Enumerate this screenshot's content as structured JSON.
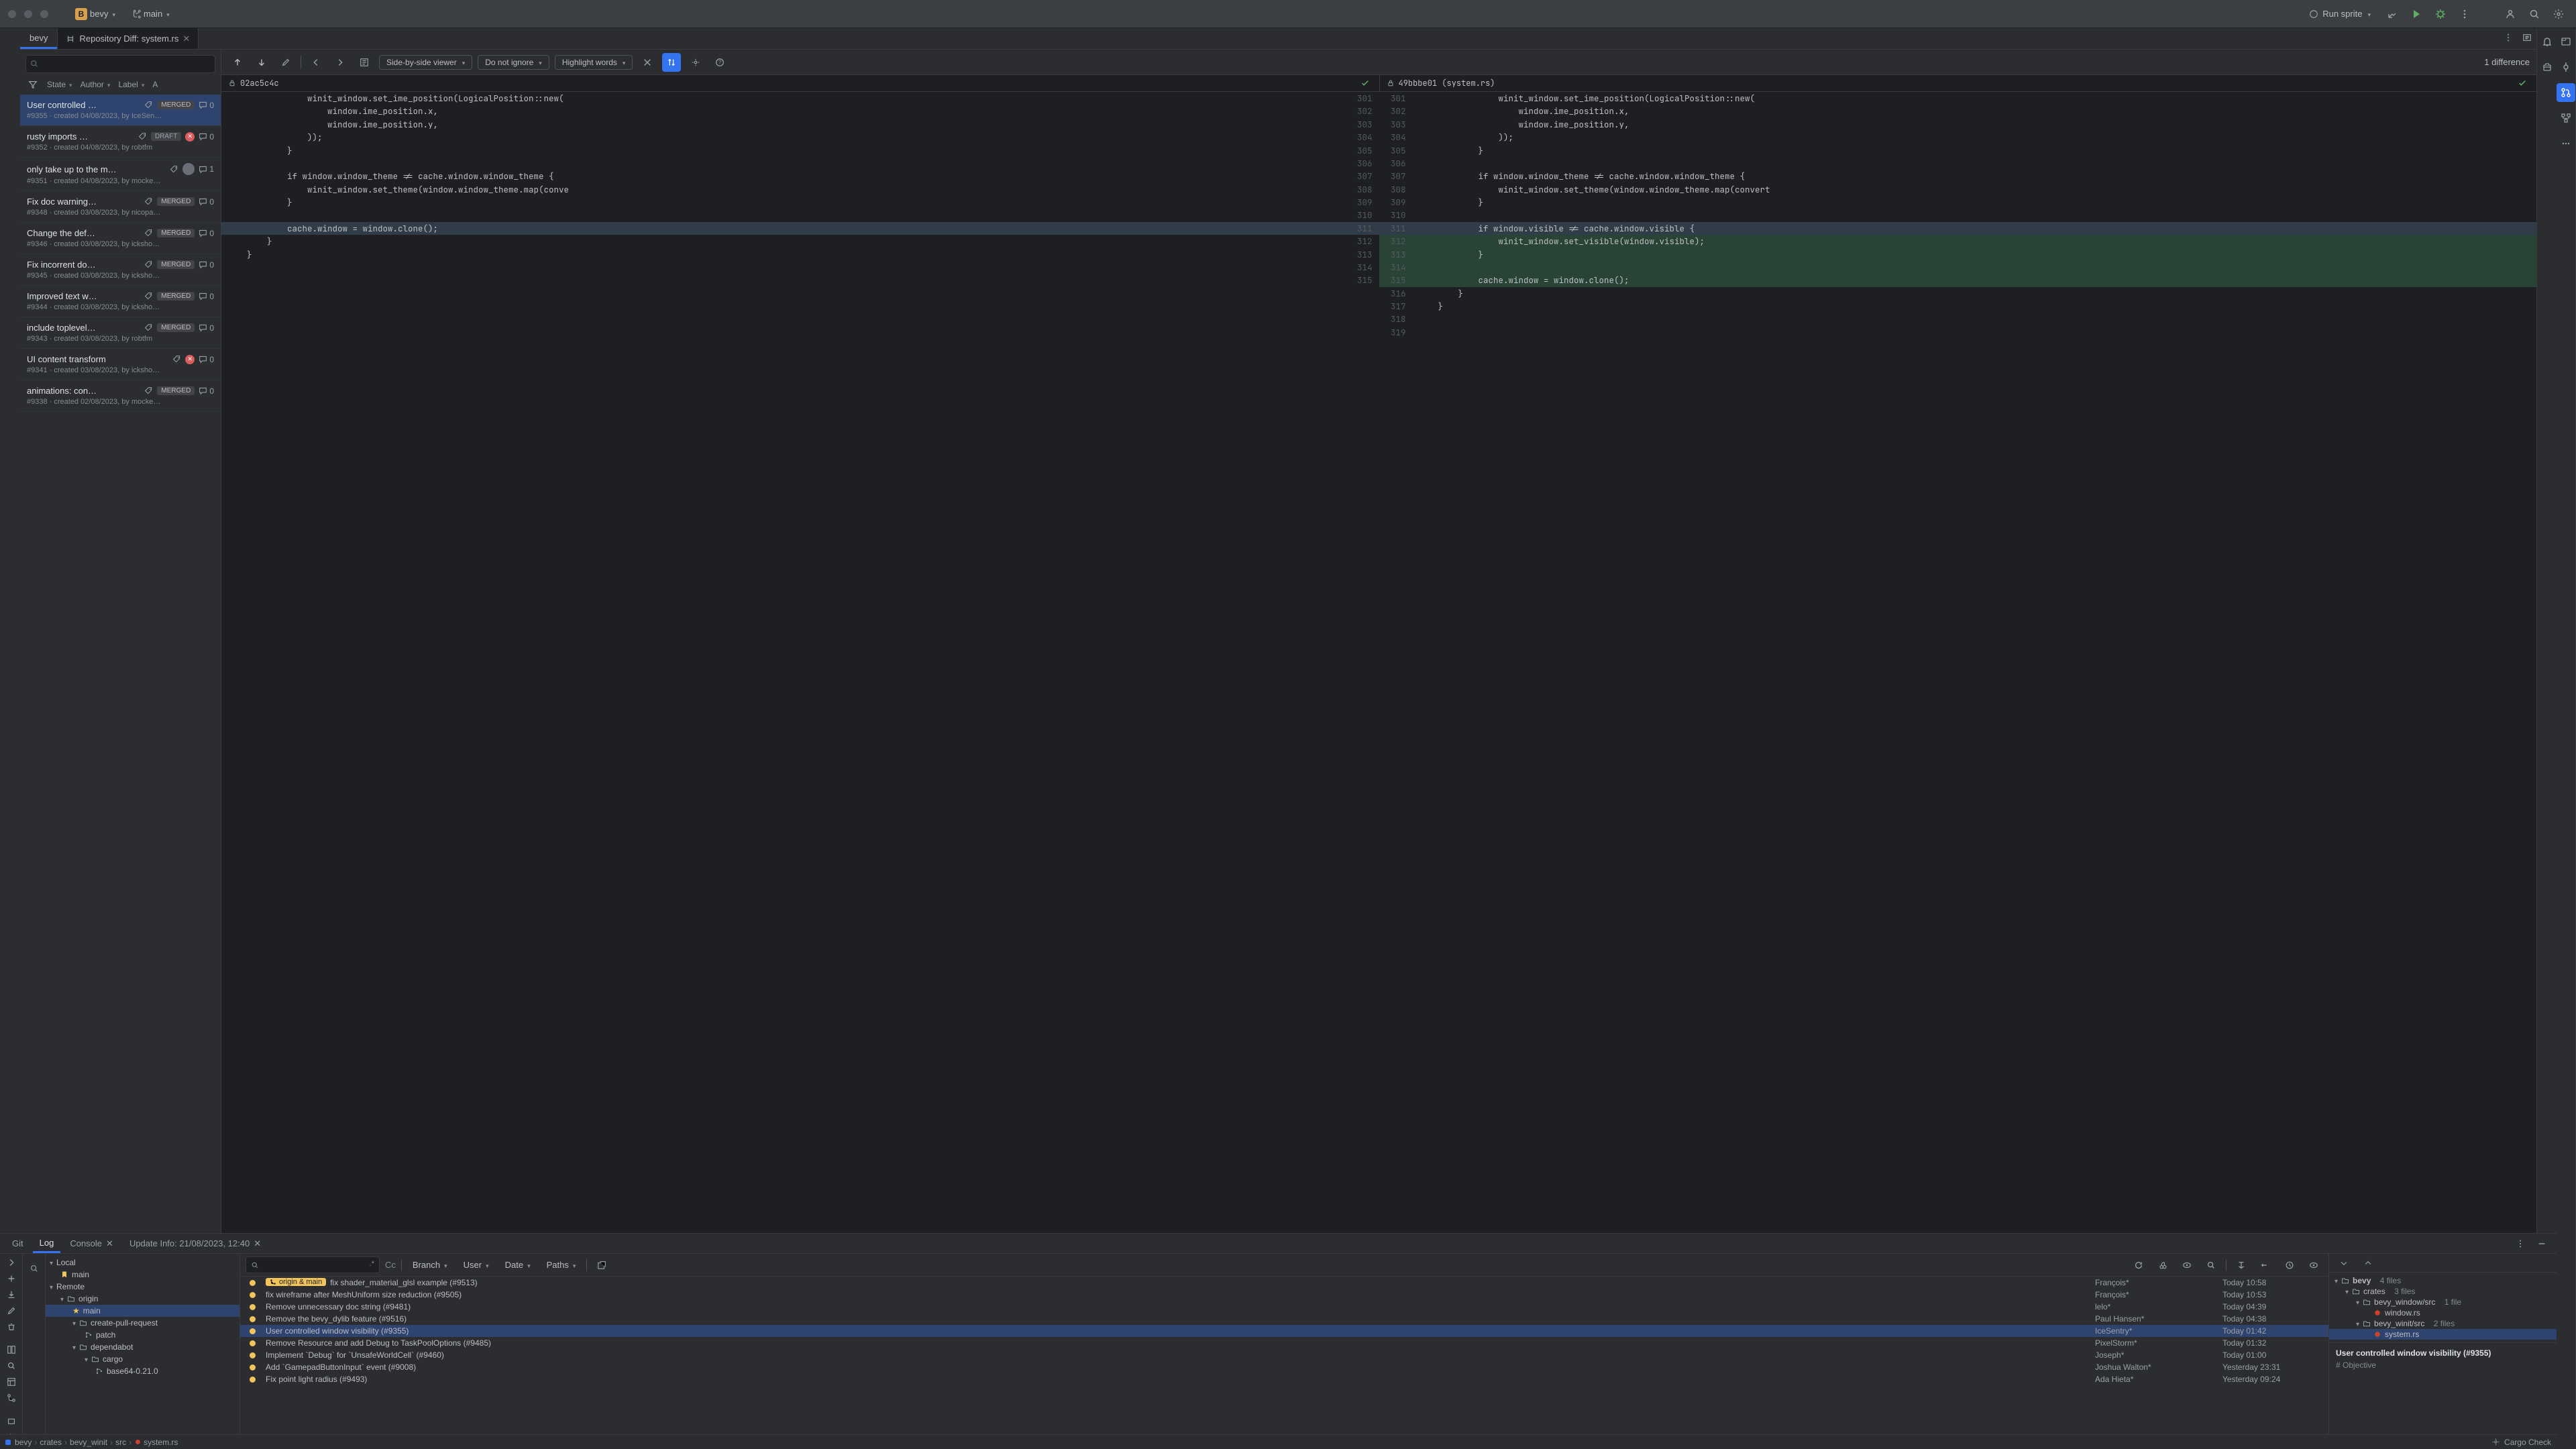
{
  "titlebar": {
    "project_initial": "B",
    "project_name": "bevy",
    "branch": "main",
    "run_config": "Run sprite"
  },
  "project_tab": "bevy",
  "editor_tab": "Repository Diff: system.rs",
  "filters": {
    "state": "State",
    "author": "Author",
    "label": "Label",
    "assignee": "A"
  },
  "pull_requests": [
    {
      "title": "User controlled …",
      "badge": "MERGED",
      "comments": "0",
      "meta": "#9355 · created 04/08/2023, by IceSen…",
      "sel": true
    },
    {
      "title": "rusty imports …",
      "badge": "DRAFT",
      "comments": "0",
      "meta": "#9352 · created 04/08/2023, by robtfm",
      "failed": true
    },
    {
      "title": "only take up to the m…",
      "badge": "",
      "comments": "1",
      "meta": "#9351 · created 04/08/2023, by mocke…",
      "avatar": true
    },
    {
      "title": "Fix doc warning…",
      "badge": "MERGED",
      "comments": "0",
      "meta": "#9348 · created 03/08/2023, by nicopa…"
    },
    {
      "title": "Change the def…",
      "badge": "MERGED",
      "comments": "0",
      "meta": "#9346 · created 03/08/2023, by icksho…"
    },
    {
      "title": "Fix incorrent do…",
      "badge": "MERGED",
      "comments": "0",
      "meta": "#9345 · created 03/08/2023, by icksho…"
    },
    {
      "title": "Improved text w…",
      "badge": "MERGED",
      "comments": "0",
      "meta": "#9344 · created 03/08/2023, by icksho…"
    },
    {
      "title": "include toplevel…",
      "badge": "MERGED",
      "comments": "0",
      "meta": "#9343 · created 03/08/2023, by robtfm"
    },
    {
      "title": "UI content transform",
      "badge": "",
      "comments": "0",
      "meta": "#9341 · created 03/08/2023, by icksho…",
      "failed": true
    },
    {
      "title": "animations: con…",
      "badge": "MERGED",
      "comments": "0",
      "meta": "#9338 · created 02/08/2023, by mocke…"
    }
  ],
  "diff_toolbar": {
    "viewer_mode": "Side-by-side viewer",
    "whitespace": "Do not ignore",
    "highlight": "Highlight words",
    "count": "1 difference"
  },
  "diff_header": {
    "left_rev": "02ac5c4c",
    "right_rev": "49bbbe01 (system.rs)"
  },
  "diff_lines": [
    {
      "l": "301",
      "r": "301",
      "lc": "                winit_window.set_ime_position(LogicalPosition::new(",
      "rc": "                winit_window.set_ime_position(LogicalPosition::new("
    },
    {
      "l": "302",
      "r": "302",
      "lc": "                    window.ime_position.x,",
      "rc": "                    window.ime_position.x,"
    },
    {
      "l": "303",
      "r": "303",
      "lc": "                    window.ime_position.y,",
      "rc": "                    window.ime_position.y,"
    },
    {
      "l": "304",
      "r": "304",
      "lc": "                ));",
      "rc": "                ));"
    },
    {
      "l": "305",
      "r": "305",
      "lc": "            }",
      "rc": "            }"
    },
    {
      "l": "306",
      "r": "306",
      "lc": "",
      "rc": ""
    },
    {
      "l": "307",
      "r": "307",
      "lc": "            if window.window_theme != cache.window.window_theme {",
      "rc": "            if window.window_theme != cache.window.window_theme {"
    },
    {
      "l": "308",
      "r": "308",
      "lc": "                winit_window.set_theme(window.window_theme.map(conve",
      "rc": "                winit_window.set_theme(window.window_theme.map(convert"
    },
    {
      "l": "309",
      "r": "309",
      "lc": "            }",
      "rc": "            }"
    },
    {
      "l": "310",
      "r": "310",
      "lc": "",
      "rc": ""
    },
    {
      "l": "311",
      "r": "311",
      "lc": "            cache.window = window.clone();",
      "rc": "            if window.visible != cache.window.visible {",
      "mod": true
    },
    {
      "l": "312",
      "r": "312",
      "lc": "        }",
      "rc": "                winit_window.set_visible(window.visible);",
      "add": true
    },
    {
      "l": "313",
      "r": "313",
      "lc": "    }",
      "rc": "            }",
      "add": true
    },
    {
      "l": "314",
      "r": "314",
      "lc": "",
      "rc": "",
      "add": true
    },
    {
      "l": "315",
      "r": "315",
      "lc": "",
      "rc": "            cache.window = window.clone();",
      "add": true
    },
    {
      "l": "",
      "r": "316",
      "lc": "",
      "rc": "        }"
    },
    {
      "l": "",
      "r": "317",
      "lc": "",
      "rc": "    }"
    },
    {
      "l": "",
      "r": "318",
      "lc": "",
      "rc": ""
    },
    {
      "l": "",
      "r": "319",
      "lc": "",
      "rc": ""
    }
  ],
  "bottom_tabs": {
    "git": "Git",
    "log": "Log",
    "console": "Console",
    "update_info": "Update Info: 21/08/2023, 12:40"
  },
  "branch_tree": {
    "local": "Local",
    "local_main": "main",
    "remote": "Remote",
    "origin": "origin",
    "origin_main": "main",
    "cpr": "create-pull-request",
    "patch": "patch",
    "dependabot": "dependabot",
    "cargo": "cargo",
    "base64": "base64-0.21.0"
  },
  "commit_filters": {
    "match_case": "Cc",
    "branch": "Branch",
    "user": "User",
    "date": "Date",
    "paths": "Paths"
  },
  "commits": [
    {
      "msg": "fix shader_material_glsl example (#9513)",
      "head": "origin & main",
      "auth": "François*",
      "date": "Today 10:58"
    },
    {
      "msg": "fix wireframe after MeshUniform size reduction (#9505)",
      "auth": "François*",
      "date": "Today 10:53"
    },
    {
      "msg": "Remove unnecessary doc string (#9481)",
      "auth": "lelo*",
      "date": "Today 04:39"
    },
    {
      "msg": "Remove the bevy_dylib feature (#9516)",
      "auth": "Paul Hansen*",
      "date": "Today 04:38"
    },
    {
      "msg": "User controlled window visibility (#9355)",
      "auth": "IceSentry*",
      "date": "Today 01:42",
      "sel": true
    },
    {
      "msg": "Remove Resource and add Debug to TaskPoolOptions (#9485)",
      "auth": "PixelStorm*",
      "date": "Today 01:32"
    },
    {
      "msg": "Implement `Debug` for `UnsafeWorldCell` (#9460)",
      "auth": "Joseph*",
      "date": "Today 01:00"
    },
    {
      "msg": "Add `GamepadButtonInput` event (#9008)",
      "auth": "Joshua Walton*",
      "date": "Yesterday 23:31"
    },
    {
      "msg": "Fix point light radius (#9493)",
      "auth": "Ada Hieta*",
      "date": "Yesterday 09:24"
    }
  ],
  "file_tree": {
    "root": "bevy",
    "root_count": "4 files",
    "crates": "crates",
    "crates_count": "3 files",
    "bevy_window": "bevy_window/src",
    "bevy_window_count": "1 file",
    "window_rs": "window.rs",
    "bevy_winit": "bevy_winit/src",
    "bevy_winit_count": "2 files",
    "system_rs": "system.rs"
  },
  "commit_meta": {
    "title": "User controlled window visibility (#9355)",
    "objective": "# Objective"
  },
  "breadcrumb": [
    "bevy",
    "crates",
    "bevy_winit",
    "src",
    "system.rs"
  ],
  "status_right": "Cargo Check"
}
